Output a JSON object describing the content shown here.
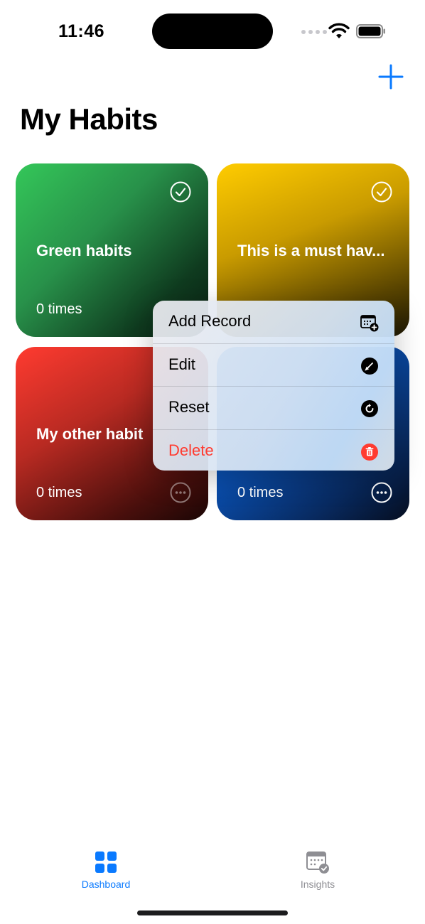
{
  "status_bar": {
    "time": "11:46"
  },
  "header": {
    "title": "My Habits",
    "add_icon": "plus-icon"
  },
  "habits": [
    {
      "name": "Green habits",
      "count": "0 times",
      "color": "#34c759",
      "completed": true
    },
    {
      "name": "This is a must hav...",
      "count": "",
      "color": "#ffcc00",
      "completed": true
    },
    {
      "name": "My other habit",
      "count": "0 times",
      "color": "#ff3b30",
      "completed": false
    },
    {
      "name": "",
      "count": "0 times",
      "color": "#0a84ff",
      "completed": false
    }
  ],
  "context_menu": {
    "items": [
      {
        "label": "Add Record",
        "icon": "calendar-add-icon"
      },
      {
        "label": "Edit",
        "icon": "pencil-icon"
      },
      {
        "label": "Reset",
        "icon": "reset-icon"
      },
      {
        "label": "Delete",
        "icon": "trash-icon",
        "color": "#ff3b30"
      }
    ]
  },
  "tab_bar": {
    "tabs": [
      {
        "label": "Dashboard",
        "icon": "grid-icon",
        "active": true,
        "color": "#0a7aff"
      },
      {
        "label": "Insights",
        "icon": "calendar-check-icon",
        "active": false,
        "color": "#8e8e93"
      }
    ]
  }
}
